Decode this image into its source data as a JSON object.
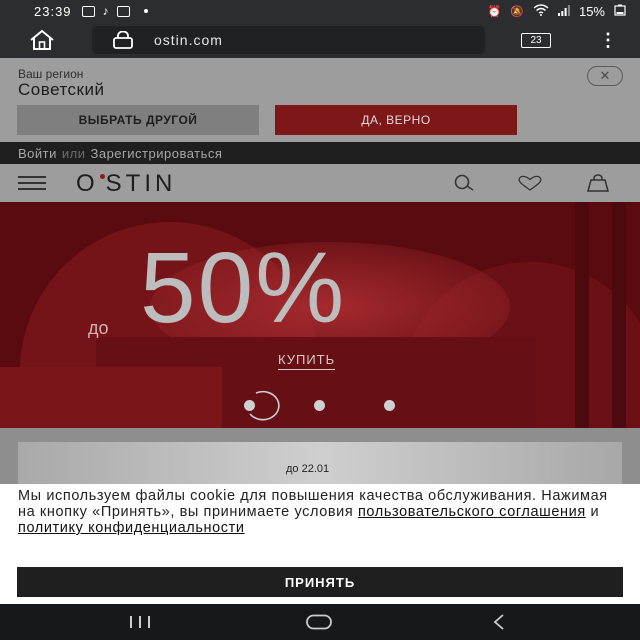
{
  "status_bar": {
    "time": "23:39",
    "battery": "15%"
  },
  "browser": {
    "url": "ostin.com",
    "tab_count": "23",
    "menu_glyph": "⋮"
  },
  "region_prompt": {
    "title": "Ваш регион",
    "city": "Советский",
    "choose_other_label": "ВЫБРАТЬ ДРУГОЙ",
    "confirm_label": "ДА, ВЕРНО",
    "close_glyph": "✕"
  },
  "auth": {
    "login": "Войти",
    "or": "или",
    "register": "Зарегистрироваться"
  },
  "header": {
    "logo_left": "O",
    "logo_right": "STIN"
  },
  "banner": {
    "prefix": "до",
    "value": "50%",
    "buy_label": "КУПИТЬ",
    "slides_total": 3,
    "active_slide": 1
  },
  "promo_strip": {
    "date": "до 22.01"
  },
  "cookie_notice": {
    "text": "Мы используем файлы cookie для повышения качества обслуживания. Нажимая на кнопку «Принять», вы принимаете условия",
    "link_agreement": "пользовательского соглашения",
    "and": "и",
    "link_privacy": "политику конфиденциальности",
    "accept_label": "ПРИНЯТЬ"
  },
  "icons": {
    "status": [
      "gallery-icon",
      "tiktok-icon",
      "mail-icon",
      "alarm-icon",
      "mute-icon",
      "wifi-icon",
      "signal-icon",
      "battery-icon"
    ],
    "header": [
      "search-icon",
      "heart-icon",
      "bag-icon"
    ],
    "nav": [
      "recents-icon",
      "home-icon",
      "back-icon"
    ]
  },
  "colors": {
    "brand_red": "#7e1717",
    "banner_red": "#5a0b10",
    "dark": "#1f1f1f"
  }
}
